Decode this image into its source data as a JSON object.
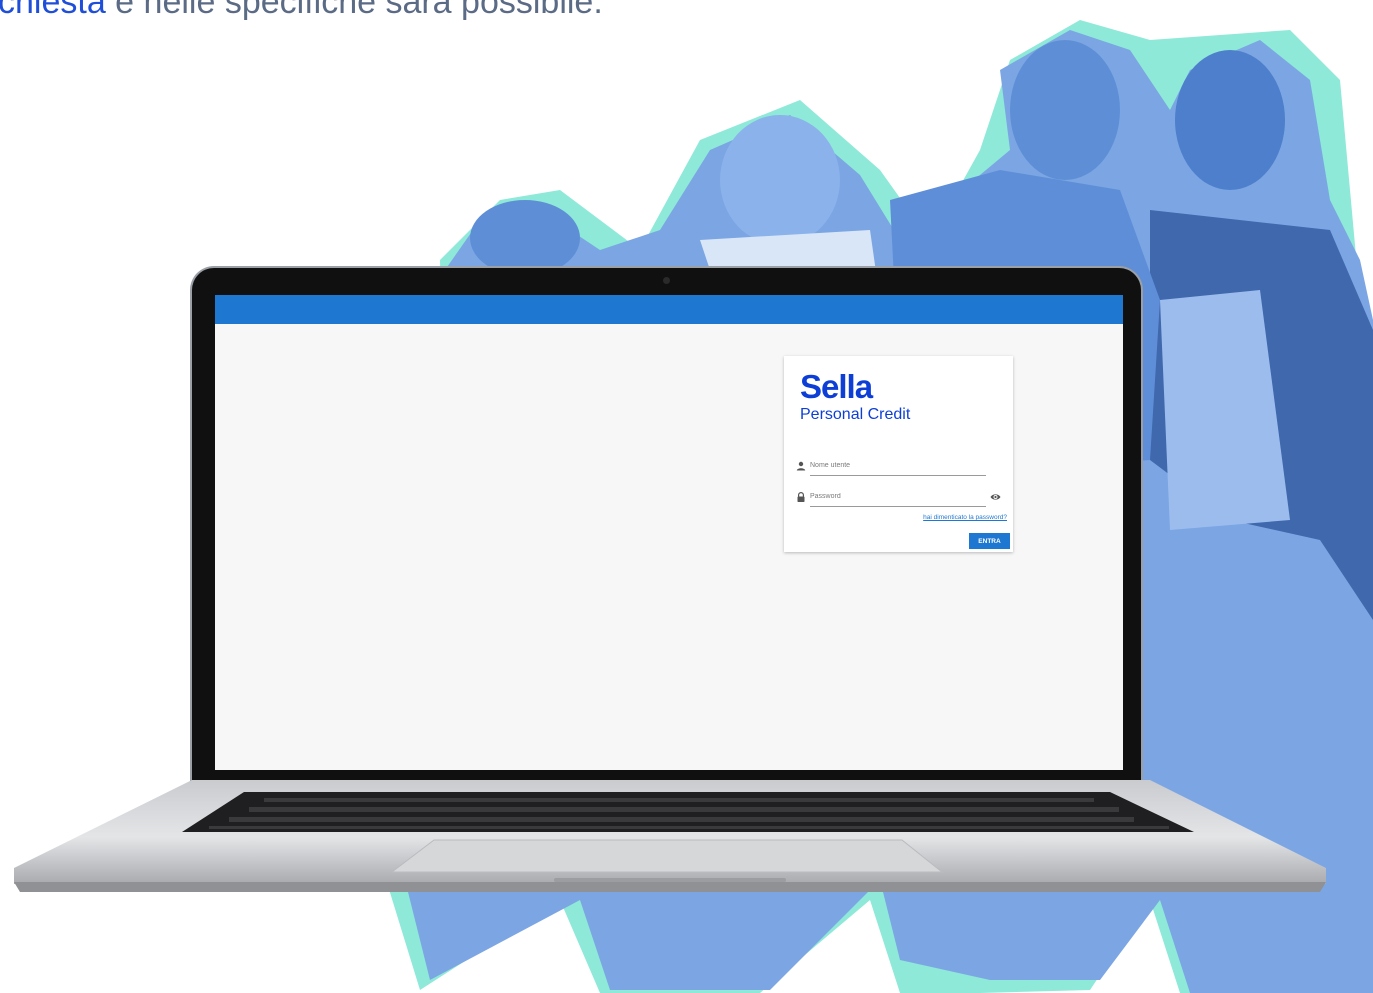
{
  "heading": {
    "link_text": "chiesta",
    "rest_text": " e nelle specifiche sarà possibile."
  },
  "login": {
    "logo_main": "Sella",
    "logo_sub": "Personal Credit",
    "username_placeholder": "Nome utente",
    "password_placeholder": "Password",
    "forgot_link": "hai dimenticato la password?",
    "submit_label": "ENTRA"
  },
  "colors": {
    "app_bar": "#1e78d2",
    "brand_blue": "#0d3fd6",
    "accent_teal": "#7fe6d2",
    "photo_tint": "#6f9fe0"
  },
  "icons": [
    "user-icon",
    "lock-icon",
    "eye-icon"
  ]
}
